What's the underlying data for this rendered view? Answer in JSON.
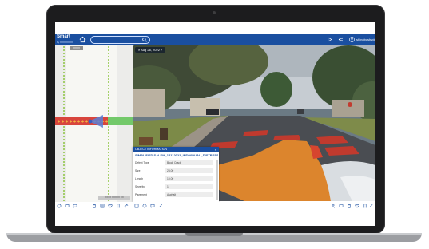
{
  "app": {
    "brand": "Smart",
    "brand_sub": "by XXXXXXXX",
    "user_name": "shinobushydro",
    "search_placeholder": "",
    "accent_color": "#1a4fa0"
  },
  "imagery": {
    "date_label": "Aug 26, 2022"
  },
  "map": {
    "road_label": "XXXX",
    "scale_label": "XXXX XXXXX XX"
  },
  "object_panel": {
    "header": "OBJECT INFORMATION",
    "close": "×",
    "title": "SIMPLIFIED SALEM_14112022_INDIVIDUAL_DISTRESS",
    "properties": [
      {
        "name": "Defect Type",
        "value": "Block Crack"
      },
      {
        "name": "Size",
        "value": "23.00"
      },
      {
        "name": "Length",
        "value": "10.00"
      },
      {
        "name": "Severity",
        "value": "1"
      },
      {
        "name": "Pavement",
        "value": "Asphalt"
      }
    ]
  },
  "icons": {
    "home": "home-icon",
    "search": "search-icon",
    "play": "play-icon",
    "share": "share-icon",
    "user": "user-icon"
  }
}
